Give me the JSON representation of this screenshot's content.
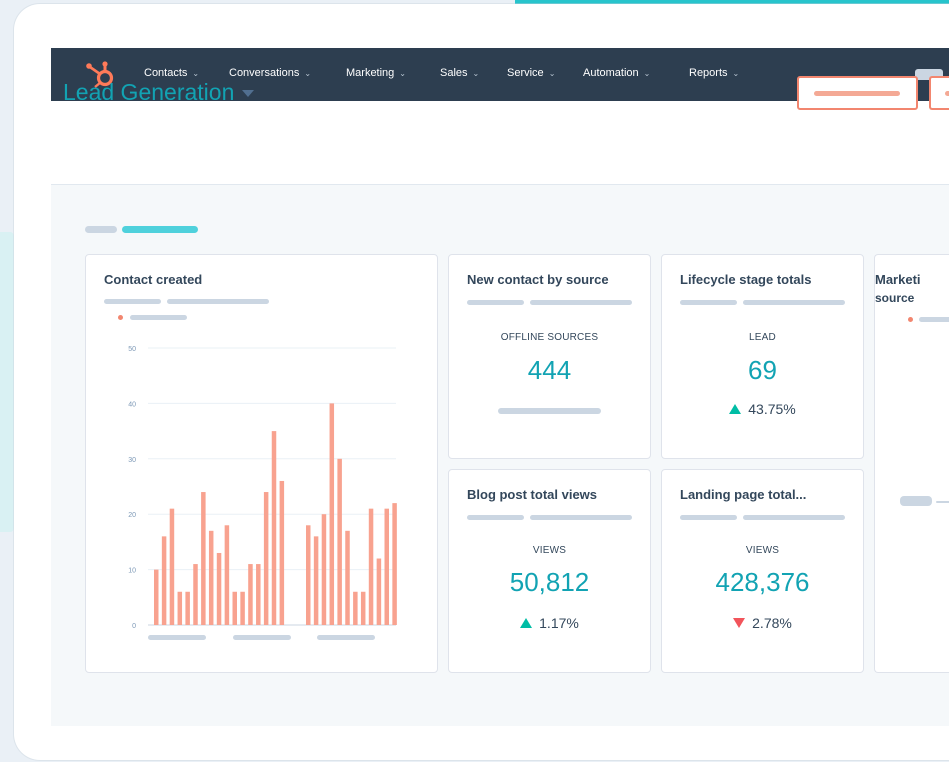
{
  "nav": {
    "items": [
      "Contacts",
      "Conversations",
      "Marketing",
      "Sales",
      "Service",
      "Automation",
      "Reports"
    ],
    "chevron": "⌄"
  },
  "header": {
    "title": "Lead Generation"
  },
  "cards": {
    "contact_created": {
      "title": "Contact created"
    },
    "new_contact": {
      "title": "New contact by source",
      "label": "OFFLINE SOURCES",
      "value": "444"
    },
    "lifecycle": {
      "title": "Lifecycle stage totals",
      "label": "LEAD",
      "value": "69",
      "delta": "43.75%"
    },
    "blog": {
      "title": "Blog post total views",
      "label": "VIEWS",
      "value": "50,812",
      "delta": "1.17%"
    },
    "landing": {
      "title": "Landing page total...",
      "label": "VIEWS",
      "value": "428,376",
      "delta": "2.78%"
    },
    "marketing": {
      "title_line1": "Marketi",
      "title_line2": "source"
    }
  },
  "colors": {
    "nav_bg": "#2d3e50",
    "accent_teal": "#12a3b3",
    "bar_coral": "#f8a28f",
    "up_green": "#00bda5",
    "down_red": "#f2545b"
  },
  "icons": {
    "logo": "hubspot-sprocket-icon",
    "up": "triangle-up-icon",
    "down": "triangle-down-icon",
    "caret": "caret-down-icon"
  },
  "chart_data": {
    "type": "bar",
    "title": "Contact created",
    "ylim": [
      0,
      50
    ],
    "yticks": [
      0,
      10,
      20,
      30,
      40,
      50
    ],
    "grid": true,
    "series": [
      {
        "values": [
          10,
          16,
          21,
          6,
          6,
          11,
          24,
          17,
          13,
          18,
          6,
          6,
          11,
          11,
          24,
          35,
          26
        ]
      },
      {
        "values": [
          18,
          16,
          20,
          40,
          30,
          17,
          6,
          6,
          21,
          12,
          21,
          22
        ]
      }
    ]
  }
}
